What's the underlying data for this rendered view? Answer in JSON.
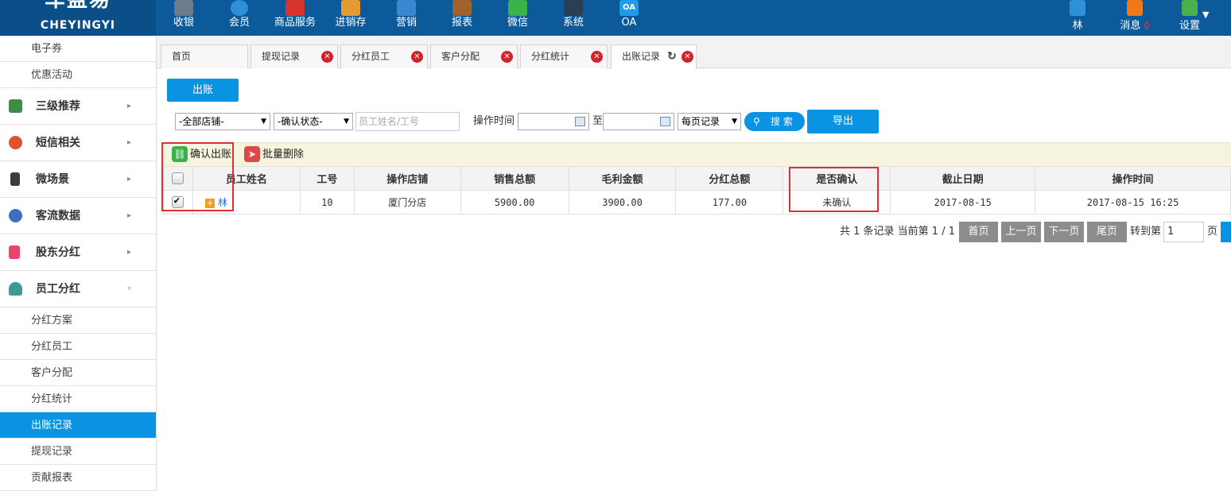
{
  "logo": {
    "cn": "车盈易",
    "en": "CHEYINGYI"
  },
  "topnav": [
    {
      "label": "收银",
      "icon": "cashier-icon",
      "color": "#6d7b8c"
    },
    {
      "label": "会员",
      "icon": "member-icon",
      "color": "#2f8fd8"
    },
    {
      "label": "商品服务",
      "icon": "product-icon",
      "color": "#d9342b"
    },
    {
      "label": "进销存",
      "icon": "inventory-icon",
      "color": "#e39b32"
    },
    {
      "label": "营销",
      "icon": "marketing-icon",
      "color": "#3a86d0"
    },
    {
      "label": "报表",
      "icon": "report-icon",
      "color": "#a0622d"
    },
    {
      "label": "微信",
      "icon": "wechat-icon",
      "color": "#3bb34a"
    },
    {
      "label": "系统",
      "icon": "system-icon",
      "color": "#2c3e55"
    },
    {
      "label": "OA",
      "icon": "oa-icon",
      "color": "#1f9be8",
      "badge_text": "OA"
    }
  ],
  "user": {
    "name": "林",
    "messages_label": "消息",
    "messages_count": "0",
    "settings_label": "设置",
    "settings_arrow": "▼"
  },
  "sidebar": {
    "items": [
      {
        "type": "sub",
        "label": "电子券"
      },
      {
        "type": "sub",
        "label": "优惠活动"
      },
      {
        "type": "group",
        "label": "三级推荐",
        "icon": "layers-icon",
        "color": "#3d8c47"
      },
      {
        "type": "group",
        "label": "短信相关",
        "icon": "phone-icon",
        "color": "#e0542c"
      },
      {
        "type": "group",
        "label": "微场景",
        "icon": "mobile-icon",
        "color": "#3c3c3c"
      },
      {
        "type": "group",
        "label": "客流数据",
        "icon": "chart-icon",
        "color": "#3e6fc2"
      },
      {
        "type": "group",
        "label": "股东分红",
        "icon": "document-icon",
        "color": "#e8456a"
      },
      {
        "type": "group",
        "label": "员工分红",
        "icon": "user-icon",
        "color": "#3a9a9a",
        "open": true
      },
      {
        "type": "sub",
        "label": "分红方案"
      },
      {
        "type": "sub",
        "label": "分红员工"
      },
      {
        "type": "sub",
        "label": "客户分配"
      },
      {
        "type": "sub",
        "label": "分红统计"
      },
      {
        "type": "sub",
        "label": "出账记录",
        "active": true
      },
      {
        "type": "sub",
        "label": "提现记录"
      },
      {
        "type": "sub",
        "label": "贡献报表"
      }
    ]
  },
  "tabs": [
    {
      "label": "首页",
      "closable": false
    },
    {
      "label": "提现记录",
      "closable": true
    },
    {
      "label": "分红员工",
      "closable": true
    },
    {
      "label": "客户分配",
      "closable": true
    },
    {
      "label": "分红统计",
      "closable": true
    },
    {
      "label": "出账记录",
      "closable": true,
      "active": true
    }
  ],
  "actions": {
    "payout_button": "出账"
  },
  "filters": {
    "store_select": "-全部店铺-",
    "status_select": "-确认状态-",
    "name_placeholder": "员工姓名/工号",
    "time_label": "操作时间",
    "to_label": "至",
    "per_page_select": "每页记录",
    "search_button": "搜 索",
    "export_button": "导出"
  },
  "toolbar": {
    "confirm_label": "确认出账",
    "batch_delete_label": "批量删除"
  },
  "table": {
    "headers": [
      "员工姓名",
      "工号",
      "操作店铺",
      "销售总额",
      "毛利金额",
      "分红总额",
      "是否确认",
      "截止日期",
      "操作时间"
    ],
    "rows": [
      {
        "checked": true,
        "name": "林",
        "no": "10",
        "store": "厦门分店",
        "sales": "5900.00",
        "profit": "3900.00",
        "bonus": "177.00",
        "confirmed": "未确认",
        "deadline": "2017-08-15",
        "op_time": "2017-08-15 16:25"
      }
    ]
  },
  "pager": {
    "summary": "共 1 条记录 当前第 1 / 1",
    "first": "首页",
    "prev": "上一页",
    "next": "下一页",
    "last": "尾页",
    "goto_label": "转到第",
    "page_value": "1",
    "page_unit": "页"
  }
}
